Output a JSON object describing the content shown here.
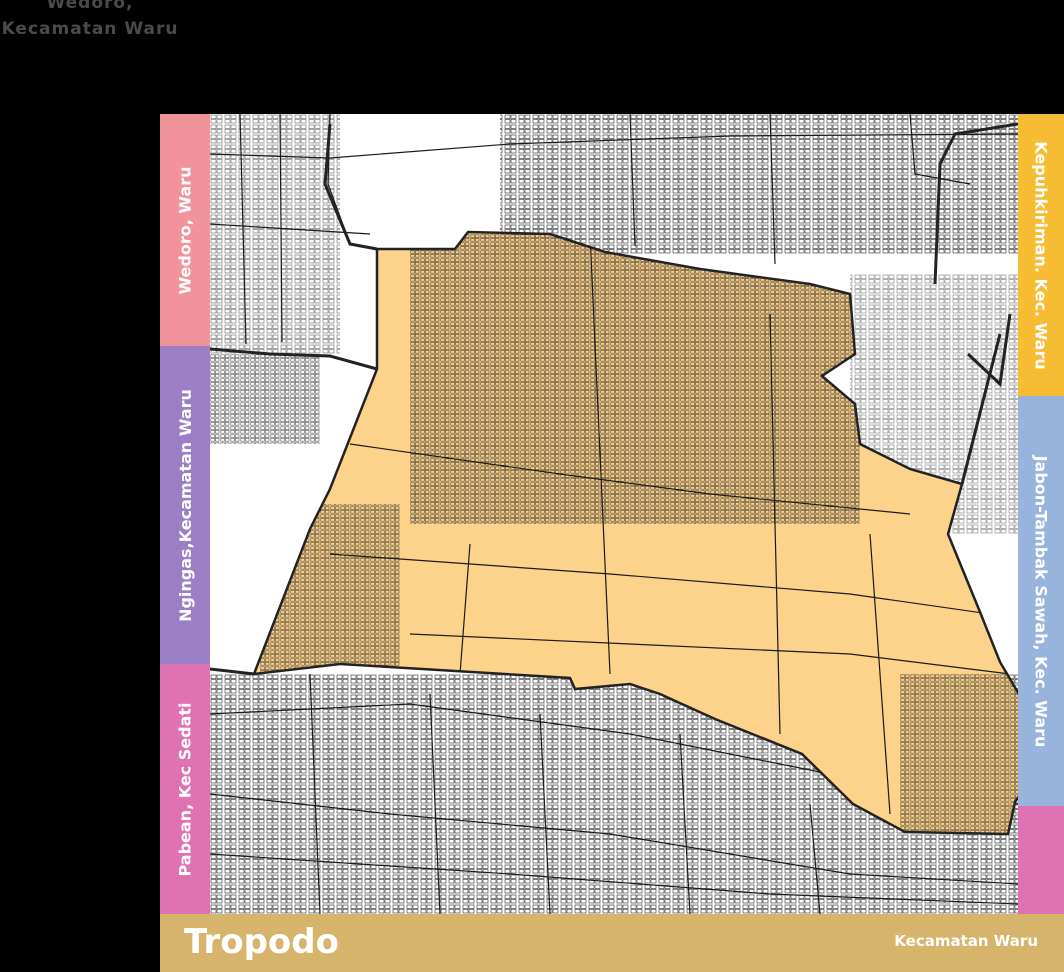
{
  "colors": {
    "background": "#000000",
    "map_bg": "#ffffff",
    "highlight": "#fdd28a",
    "road": "#1a1a1a",
    "boundary": "#222222",
    "wedoro": "#f0939b",
    "ngingas": "#9b7ec3",
    "pabean": "#df72b2",
    "kepuhkiriman": "#f5bc34",
    "jabon": "#98b4dc",
    "tropodo": "#d6b46c"
  },
  "top_ghost": {
    "line1": "Wedoro,",
    "line2": "Kecamatan Waru"
  },
  "neighbors": {
    "left_top": "Wedoro, Waru",
    "left_middle": "Ngingas,Kecamatan Waru",
    "left_bottom": "Pabean, Kec Sedati",
    "right_top": "Kepuhkiriman. Kec. Waru",
    "right_middle": "Jabon-Tambak Sawah, Kec. Waru"
  },
  "footer": {
    "title": "Tropodo",
    "subtitle": "Kecamatan Waru"
  }
}
